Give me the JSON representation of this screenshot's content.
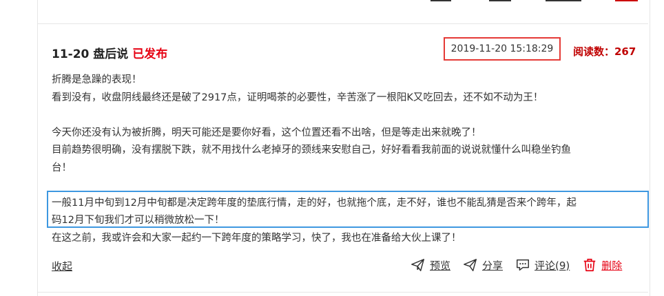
{
  "post": {
    "title": "11-20 盘后说",
    "status": "已发布",
    "timestamp": "2019-11-20 15:18:29",
    "read_count": "阅读数：267",
    "lines": [
      "折腾是急躁的表现！",
      "看到没有，收盘阴线最终还是破了2917点，证明喝茶的必要性，辛苦涨了一根阳K又吃回去，还不如不动为王！",
      "",
      "今天你还没有认为被折腾，明天可能还是要你好看，这个位置还看不出啥，但是等走出来就晚了！",
      "目前趋势很明确，没有摆脱下跌，就不用找什么老掉牙的颈线来安慰自己，好好看看我前面的说说就懂什么叫稳坐钓鱼",
      "台！",
      "",
      "一般11月中旬到12月中旬都是决定跨年度的垫底行情，走的好，也就拖个底，走不好，谁也不能乱猜是否来个跨年，起",
      "码12月下旬我们才可以稍微放松一下！",
      "在这之前，我或许会和大家一起约一下跨年度的策略学习，快了，我也在准备给大伙上课了！"
    ]
  },
  "footer": {
    "collapse_label": "收起",
    "preview_label": "预览",
    "share_label": "分享",
    "comment_label": "评论(9)",
    "delete_label": "删除"
  },
  "colors": {
    "status_red": "#e60012",
    "read_count": "#c00000",
    "time_box_border": "#e53935",
    "highlight_border": "#3d97e0"
  },
  "icons": [
    "send-icon",
    "share-icon",
    "comment-icon",
    "trash-icon"
  ]
}
